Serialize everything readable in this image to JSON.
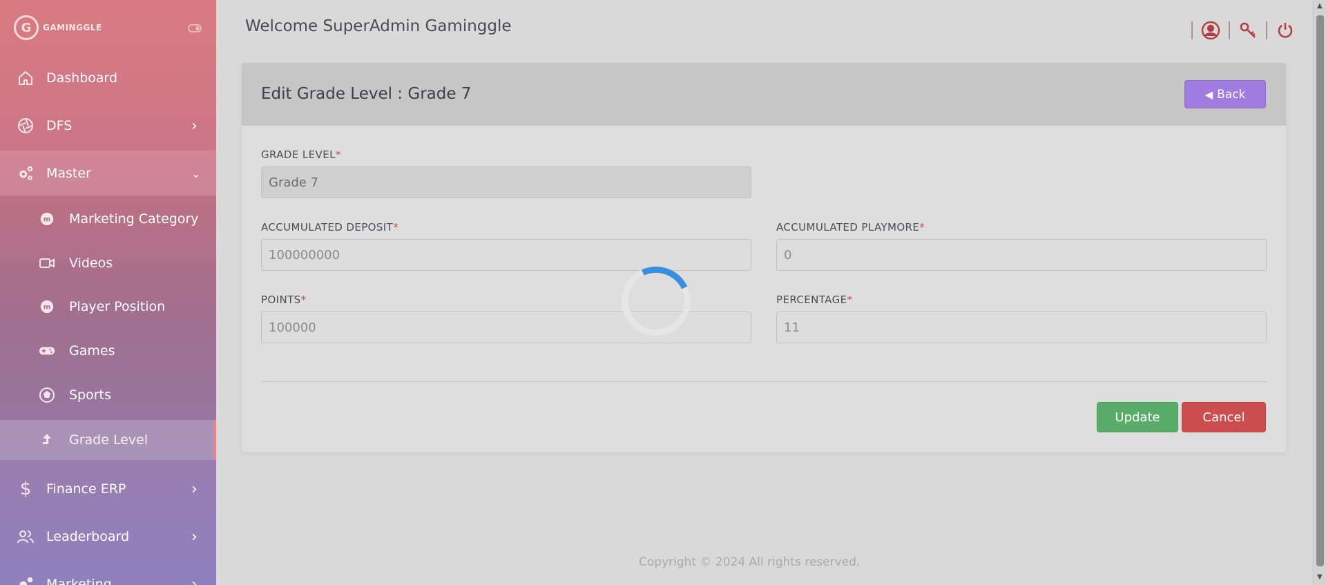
{
  "brand": {
    "logo_letter": "G",
    "name": "GAMINGGLE"
  },
  "sidebar": {
    "items": [
      {
        "label": "Dashboard",
        "icon": "home-icon"
      },
      {
        "label": "DFS",
        "icon": "aperture-icon"
      },
      {
        "label": "Master",
        "icon": "gears-icon"
      },
      {
        "label": "Finance ERP",
        "icon": "dollar-icon"
      },
      {
        "label": "Leaderboard",
        "icon": "users-icon"
      },
      {
        "label": "Marketing",
        "icon": "gears-icon"
      }
    ],
    "master_subitems": [
      {
        "label": "Marketing Category",
        "icon": "badge-icon"
      },
      {
        "label": "Videos",
        "icon": "video-icon"
      },
      {
        "label": "Player Position",
        "icon": "badge-icon"
      },
      {
        "label": "Games",
        "icon": "gamepad-icon"
      },
      {
        "label": "Sports",
        "icon": "ball-icon"
      },
      {
        "label": "Grade Level",
        "icon": "arrow-up-icon"
      }
    ]
  },
  "header": {
    "welcome": "Welcome SuperAdmin Gaminggle"
  },
  "card": {
    "title": "Edit Grade Level : Grade 7",
    "back_label": "Back"
  },
  "form": {
    "grade_level": {
      "label": "GRADE LEVEL",
      "value": "Grade 7"
    },
    "accumulated_deposit": {
      "label": "ACCUMULATED DEPOSIT",
      "value": "100000000"
    },
    "accumulated_playmore": {
      "label": "ACCUMULATED PLAYMORE",
      "value": "0"
    },
    "points": {
      "label": "POINTS",
      "value": "100000"
    },
    "percentage": {
      "label": "PERCENTAGE",
      "value": "11"
    },
    "required_mark": "*"
  },
  "actions": {
    "update": "Update",
    "cancel": "Cancel"
  },
  "footer": {
    "text": "Copyright © 2024  All rights reserved."
  },
  "colors": {
    "accent_purple": "#a07ce0",
    "update_green": "#5aac6a",
    "cancel_red": "#cc4d4d",
    "spinner_blue": "#3a8ee0"
  }
}
